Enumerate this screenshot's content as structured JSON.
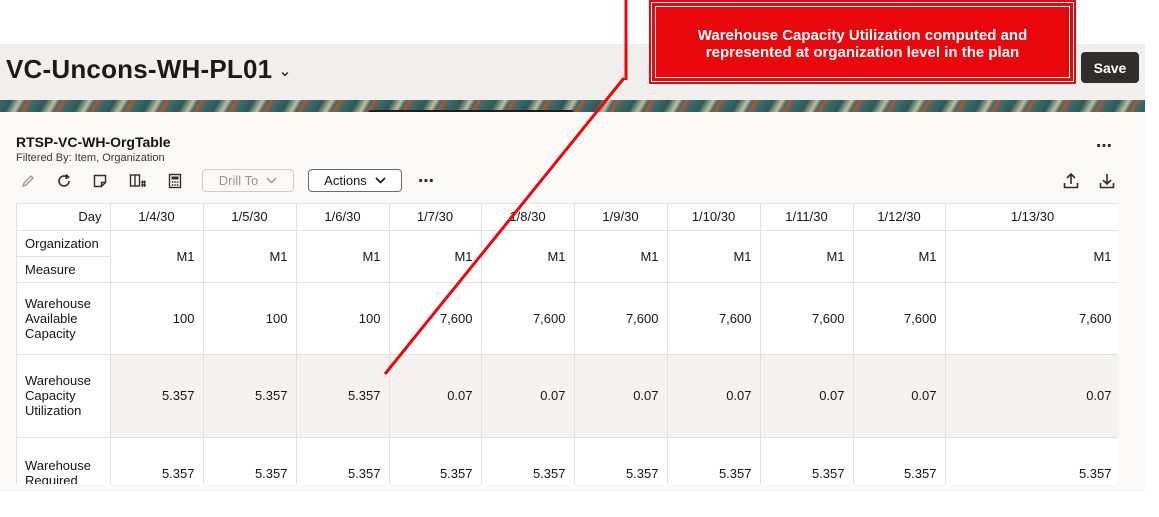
{
  "header": {
    "plan_name": "VC-Uncons-WH-PL01",
    "plan_name_chevron": "⌄",
    "save_label": "Save"
  },
  "callout": {
    "line1": "Warehouse Capacity Utilization computed and",
    "line2": "represented at organization level in the plan",
    "color": "#e8070d"
  },
  "table": {
    "title": "RTSP-VC-WH-OrgTable",
    "filter": "Filtered By: Item, Organization",
    "more_icon": "⋯"
  },
  "toolbar": {
    "icons": [
      "pencil-icon",
      "refresh-icon",
      "note-icon",
      "grid-pin-icon",
      "calculator-icon"
    ],
    "drill_label": "Drill To",
    "actions_label": "Actions",
    "more_icon": "⋯",
    "upload_icon": "upload-icon",
    "download_icon": "download-icon"
  },
  "grid": {
    "day_label": "Day",
    "organization_label": "Organization",
    "measure_label": "Measure",
    "dates": [
      "1/4/30",
      "1/5/30",
      "1/6/30",
      "1/7/30",
      "1/8/30",
      "1/9/30",
      "1/10/30",
      "1/11/30",
      "1/12/30",
      "1/13/30"
    ],
    "organizations": [
      "M1",
      "M1",
      "M1",
      "M1",
      "M1",
      "M1",
      "M1",
      "M1",
      "M1",
      "M1"
    ],
    "rows": [
      {
        "label_lines": [
          "Warehouse",
          "Available",
          "Capacity"
        ],
        "values": [
          "100",
          "100",
          "100",
          "7,600",
          "7,600",
          "7,600",
          "7,600",
          "7,600",
          "7,600",
          "7,600"
        ]
      },
      {
        "label_lines": [
          "Warehouse",
          "Capacity",
          "Utilization"
        ],
        "values": [
          "5.357",
          "5.357",
          "5.357",
          "0.07",
          "0.07",
          "0.07",
          "0.07",
          "0.07",
          "0.07",
          "0.07"
        ]
      },
      {
        "label_lines": [
          "Warehouse",
          "Required"
        ],
        "values": [
          "5.357",
          "5.357",
          "5.357",
          "5.357",
          "5.357",
          "5.357",
          "5.357",
          "5.357",
          "5.357",
          "5.357"
        ]
      }
    ]
  },
  "colors": {
    "save_button": "#312d2a",
    "header_bg": "#f1efed",
    "shaded_row": "#f4f3f2"
  }
}
